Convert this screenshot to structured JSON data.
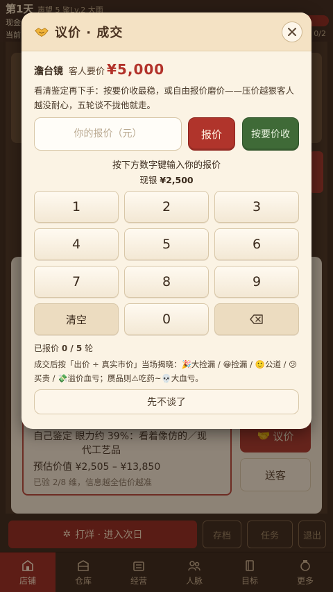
{
  "background": {
    "day": "第1天",
    "reputation": "声望 5  鉴Lv.2  大雨",
    "line2": "现金",
    "line3": "当前",
    "count": "0/2",
    "sub_row1": "自己鉴定  眼力约 39%：看着像仿的／现",
    "sub_row1b": "代工艺品",
    "sub_row2": "预估价值  ¥2,505 – ¥13,850",
    "sub_row3": "已验 2/8 维，信息越全估价越准",
    "bargain_label": "议价",
    "gift_label": "送客",
    "close_shop_label": "打烊 · 进入次日",
    "save_label": "存档",
    "task_label": "任务",
    "exit_label": "退出"
  },
  "tabs": [
    {
      "label": "店铺",
      "icon": "shop-icon",
      "active": true
    },
    {
      "label": "仓库",
      "icon": "warehouse-icon",
      "active": false
    },
    {
      "label": "经营",
      "icon": "register-icon",
      "active": false
    },
    {
      "label": "人脉",
      "icon": "people-icon",
      "active": false
    },
    {
      "label": "目标",
      "icon": "book-icon",
      "active": false
    },
    {
      "label": "更多",
      "icon": "pot-icon",
      "active": false
    }
  ],
  "modal": {
    "title": "议价 · 成交",
    "item_name": "澹台镜",
    "ask_label": "客人要价",
    "ask_price": "¥5,000",
    "description": "看清鉴定再下手：按要价收最稳，或自由报价磨价——压价越狠客人越没耐心，五轮谈不拢他就走。",
    "input_placeholder": "你的报价（元）",
    "input_value": "",
    "offer_button": "报价",
    "accept_button": "按要价收",
    "keypad_hint": "按下方数字键输入你的报价",
    "cash_label": "现银",
    "cash_value": "¥2,500",
    "keys": [
      "1",
      "2",
      "3",
      "4",
      "5",
      "6",
      "7",
      "8",
      "9"
    ],
    "clear_key": "清空",
    "zero_key": "0",
    "rounds_label": "已报价",
    "rounds_value": "0 / 5",
    "rounds_unit": "轮",
    "rule_text": "成交后按「出价 ÷ 真实市价」当场揭晓：🎉大捡漏 / 😀捡漏 / 🙂公道 / 😕买贵 / 💸溢价血亏；赝品则⚠吃药~💀大血亏。",
    "quit_button": "先不谈了"
  },
  "colors": {
    "accent_red": "#b0342b",
    "accent_green": "#3f6a37",
    "price_red": "#b2322a",
    "modal_bg": "#fbf3e4"
  }
}
